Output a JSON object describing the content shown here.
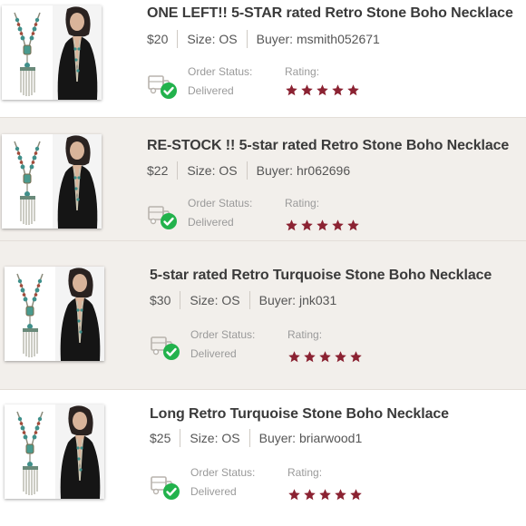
{
  "labels": {
    "order_status": "Order Status:",
    "rating": "Rating:",
    "size_prefix": "Size:",
    "buyer_prefix": "Buyer:"
  },
  "colors": {
    "star": "#8b2232",
    "delivered_check": "#22b24c",
    "alt_row_bg": "#f2efeb"
  },
  "orders": [
    {
      "title": "ONE LEFT!! 5-STAR rated Retro Stone Boho Necklace",
      "price": "$20",
      "size": "OS",
      "buyer": "msmith052671",
      "status": "Delivered",
      "rating": 5
    },
    {
      "title": "RE-STOCK !! 5-star rated Retro Stone Boho Necklace",
      "price": "$22",
      "size": "OS",
      "buyer": "hr062696",
      "status": "Delivered",
      "rating": 5
    },
    {
      "title": "5-star rated Retro Turquoise Stone Boho Necklace",
      "price": "$30",
      "size": "OS",
      "buyer": "jnk031",
      "status": "Delivered",
      "rating": 5
    },
    {
      "title": "Long Retro Turquoise Stone Boho Necklace",
      "price": "$25",
      "size": "OS",
      "buyer": "briarwood1",
      "status": "Delivered",
      "rating": 5
    }
  ]
}
